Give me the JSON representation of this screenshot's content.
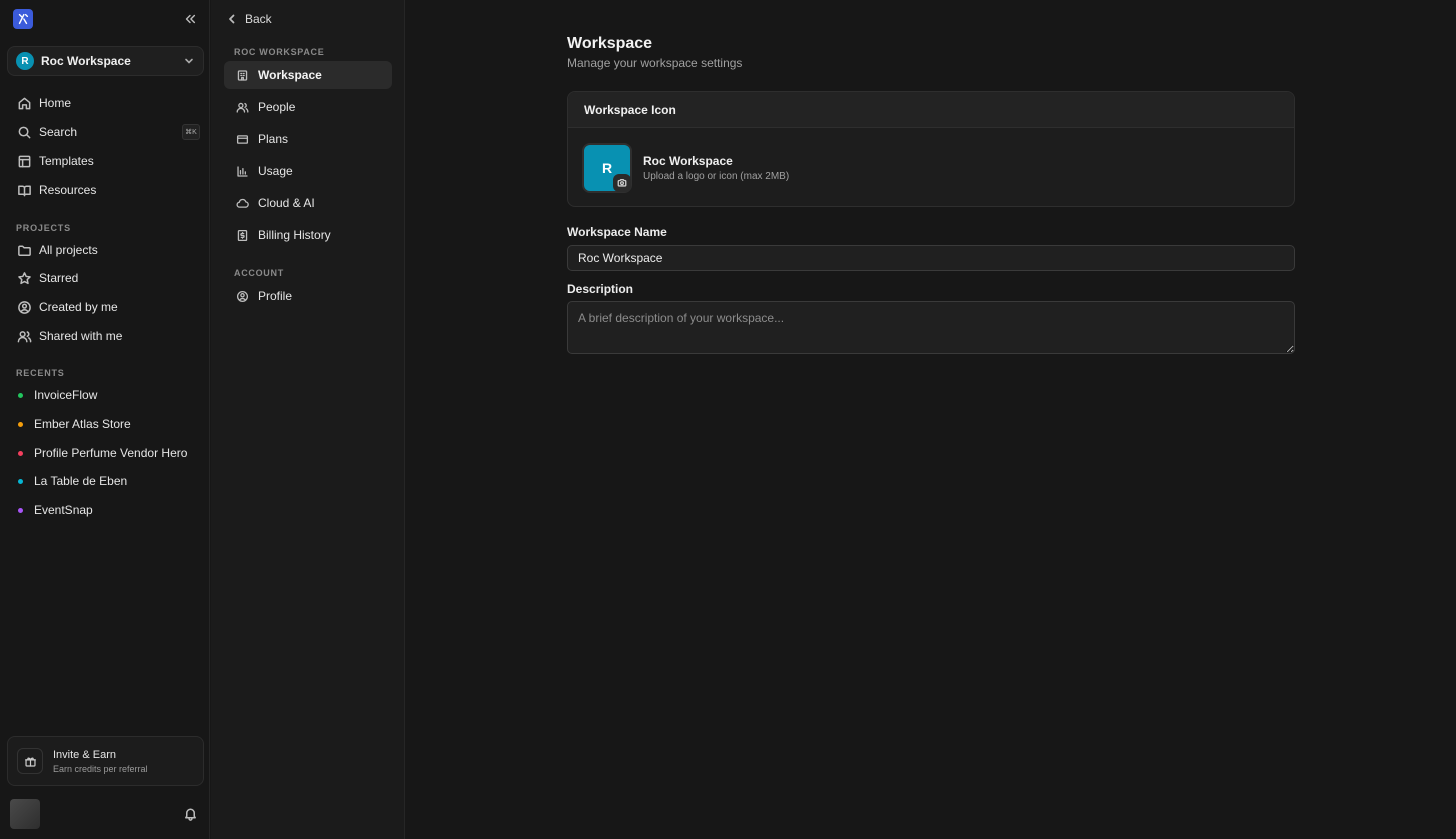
{
  "sidebar": {
    "workspace": {
      "avatar_letter": "R",
      "name": "Roc Workspace"
    },
    "nav": [
      {
        "label": "Home",
        "icon": "home-icon"
      },
      {
        "label": "Search",
        "icon": "search-icon",
        "shortcut": "⌘K"
      },
      {
        "label": "Templates",
        "icon": "templates-icon"
      },
      {
        "label": "Resources",
        "icon": "book-icon"
      }
    ],
    "projects_heading": "PROJECTS",
    "projects": [
      {
        "label": "All projects",
        "icon": "folder-icon"
      },
      {
        "label": "Starred",
        "icon": "star-icon"
      },
      {
        "label": "Created by me",
        "icon": "user-circle-icon"
      },
      {
        "label": "Shared with me",
        "icon": "users-icon"
      }
    ],
    "recents_heading": "RECENTS",
    "recents": [
      {
        "label": "InvoiceFlow",
        "color": "#22c55e"
      },
      {
        "label": "Ember Atlas Store",
        "color": "#f59e0b"
      },
      {
        "label": "Profile Perfume Vendor Hero",
        "color": "#f43f5e"
      },
      {
        "label": "La Table de Eben",
        "color": "#06b6d4"
      },
      {
        "label": "EventSnap",
        "color": "#a855f7"
      }
    ],
    "invite": {
      "title": "Invite & Earn",
      "subtitle": "Earn credits per referral"
    }
  },
  "subnav": {
    "back_label": "Back",
    "workspace_heading": "ROC WORKSPACE",
    "items": [
      {
        "label": "Workspace",
        "icon": "building-icon"
      },
      {
        "label": "People",
        "icon": "people-icon"
      },
      {
        "label": "Plans",
        "icon": "credit-card-icon"
      },
      {
        "label": "Usage",
        "icon": "bar-chart-icon"
      },
      {
        "label": "Cloud & AI",
        "icon": "cloud-icon"
      },
      {
        "label": "Billing History",
        "icon": "receipt-icon"
      }
    ],
    "account_heading": "ACCOUNT",
    "account_items": [
      {
        "label": "Profile",
        "icon": "user-circle-icon"
      }
    ]
  },
  "main": {
    "title": "Workspace",
    "subtitle": "Manage your workspace settings",
    "icon_card": {
      "heading": "Workspace Icon",
      "letter": "R",
      "name": "Roc Workspace",
      "hint": "Upload a logo or icon (max 2MB)"
    },
    "name_field": {
      "label": "Workspace Name",
      "value": "Roc Workspace"
    },
    "description_field": {
      "label": "Description",
      "value": "",
      "placeholder": "A brief description of your workspace..."
    }
  },
  "colors": {
    "accent_icon_bg": "#0891b2",
    "logo_bg": "#3b5bdb",
    "active_nav_bg": "#2b2b2b"
  }
}
